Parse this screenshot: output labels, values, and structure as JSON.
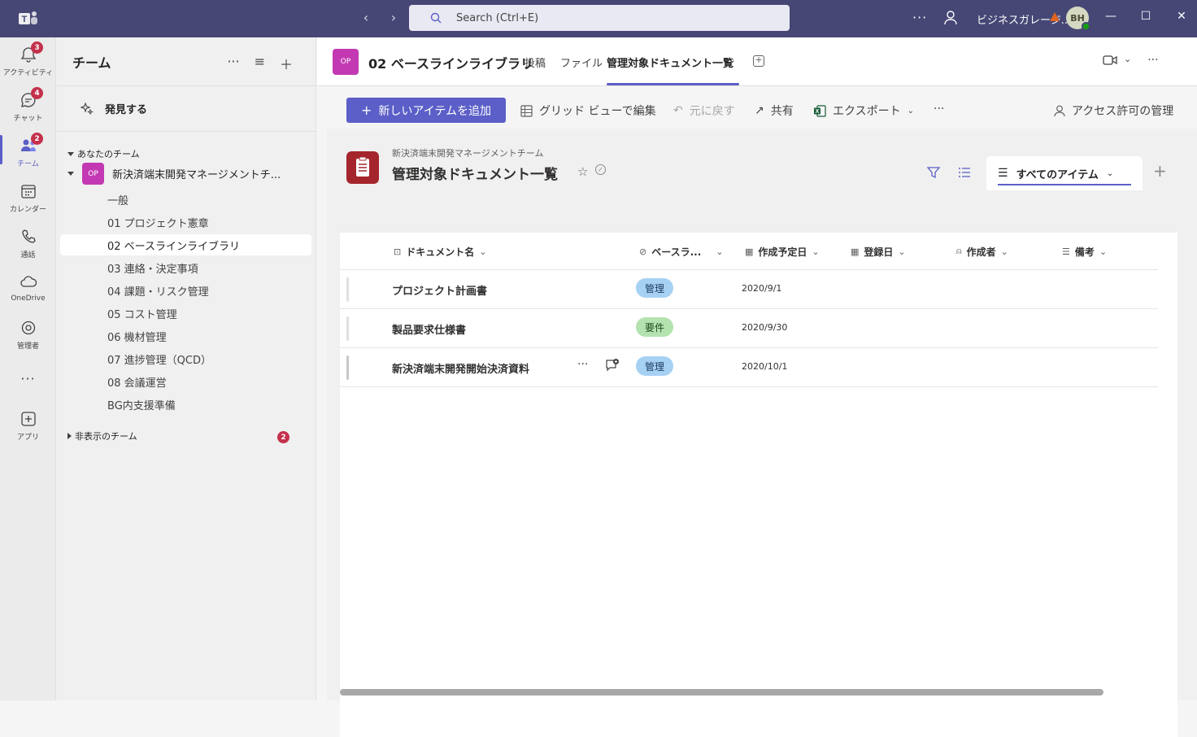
{
  "titlebar": {
    "search_placeholder": "Search (Ctrl+E)",
    "org_name": "ビジネスガレージ...",
    "avatar_initials": "BH"
  },
  "rail": {
    "items": [
      {
        "label": "アクティビティ",
        "badge": "3"
      },
      {
        "label": "チャット",
        "badge": "4"
      },
      {
        "label": "チーム",
        "badge": "2"
      },
      {
        "label": "カレンダー"
      },
      {
        "label": "通話"
      },
      {
        "label": "OneDrive"
      },
      {
        "label": "管理者"
      },
      {
        "label": "アプリ"
      }
    ]
  },
  "panel": {
    "title": "チーム",
    "discover": "発見する",
    "your_teams": "あなたのチーム",
    "team": {
      "avatar": "OP",
      "name": "新決済端末開発マネージメントチ..."
    },
    "channels": [
      "一般",
      "01 プロジェクト憲章",
      "02 ベースラインライブラリ",
      "03 連絡・決定事項",
      "04 課題・リスク管理",
      "05 コスト管理",
      "06 機材管理",
      "07 進捗管理（QCD）",
      "08 会議運営",
      "BG内支援準備"
    ],
    "hidden_teams": "非表示のチーム",
    "hidden_badge": "2"
  },
  "channel": {
    "avatar": "OP",
    "title": "02 ベースラインライブラリ",
    "tabs": [
      "投稿",
      "ファイル",
      "管理対象ドキュメント一覧"
    ]
  },
  "commands": {
    "add_item": "新しいアイテムを追加",
    "grid_edit": "グリッド ビューで編集",
    "undo": "元に戻す",
    "share": "共有",
    "export": "エクスポート",
    "more": "···",
    "access": "アクセス許可の管理"
  },
  "list": {
    "team": "新決済端末開発マネージメントチーム",
    "title": "管理対象ドキュメント一覧",
    "view": "すべてのアイテム",
    "columns": [
      "ドキュメント名",
      "ベースラ...",
      "作成予定日",
      "登録日",
      "作成者",
      "備考"
    ],
    "rows": [
      {
        "name": "プロジェクト計画書",
        "tag": "管理",
        "date": "2020/9/1"
      },
      {
        "name": "製品要求仕様書",
        "tag": "要件",
        "date": "2020/9/30"
      },
      {
        "name": "新決済端末開発開始決済資料",
        "tag": "管理",
        "date": "2020/10/1"
      }
    ]
  },
  "colors": {
    "brand": "#464775",
    "accent": "#5b5fc7",
    "badge": "#c4314b",
    "team_avatar": "#c239b3",
    "list_icon": "#a4262c"
  }
}
